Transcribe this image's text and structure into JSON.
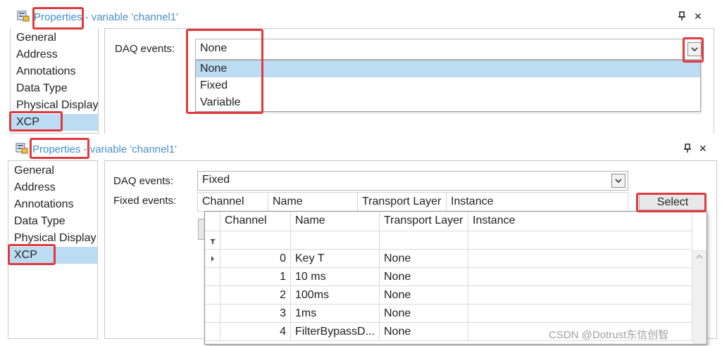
{
  "top": {
    "title_main": "Properties",
    "title_rest": " - variable 'channel1'",
    "pin": "⊞",
    "close": "✕",
    "nav": [
      "General",
      "Address",
      "Annotations",
      "Data Type",
      "Physical Display",
      "XCP"
    ],
    "daq_label": "DAQ events:",
    "daq_value": "None",
    "options": [
      "None",
      "Fixed",
      "Variable"
    ]
  },
  "bottom": {
    "title_main": "Properties",
    "title_rest": " - variable 'channel1'",
    "nav": [
      "General",
      "Address",
      "Annotations",
      "Data Type",
      "Physical Display",
      "XCP"
    ],
    "daq_label": "DAQ events:",
    "daq_value": "Fixed",
    "fixed_label": "Fixed events:",
    "grid_headers": [
      "Channel",
      "Name",
      "Transport Layer",
      "Instance"
    ],
    "select_label": "Select",
    "popup_headers": [
      "Channel",
      "Name",
      "Transport Layer",
      "Instance"
    ],
    "rows": [
      {
        "channel": "0",
        "name": "Key T",
        "transport": "None"
      },
      {
        "channel": "1",
        "name": "10 ms",
        "transport": "None"
      },
      {
        "channel": "2",
        "name": "100ms",
        "transport": "None"
      },
      {
        "channel": "3",
        "name": "1ms",
        "transport": "None"
      },
      {
        "channel": "4",
        "name": "FilterBypassD...",
        "transport": "None"
      }
    ]
  },
  "watermark": "CSDN @Dotrust东信创智",
  "colors": {
    "accent_title": "#3c8fd2",
    "selection": "#bcdcf4",
    "highlight_box": "#e0393e"
  }
}
